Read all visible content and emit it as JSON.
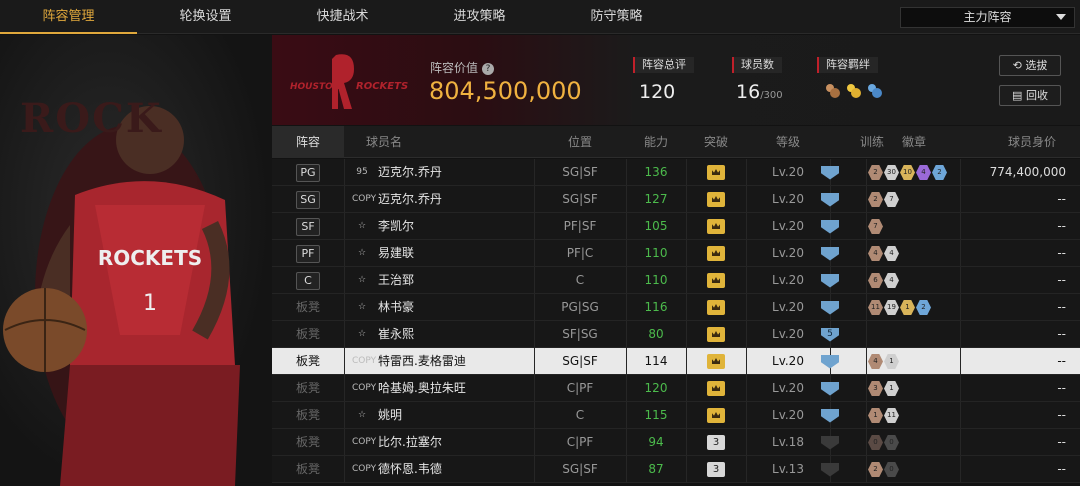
{
  "tabs": [
    {
      "label": "阵容管理"
    },
    {
      "label": "轮换设置"
    },
    {
      "label": "快捷战术"
    },
    {
      "label": "进攻策略"
    },
    {
      "label": "防守策略"
    }
  ],
  "lineup_select": {
    "value": "主力阵容"
  },
  "team": {
    "logo_text": "HOUSTON ROCKETS",
    "bg_text": "ROCK"
  },
  "lineup_value": {
    "label": "阵容价值",
    "value": "804,500,000"
  },
  "stats": {
    "rating_label": "阵容总评",
    "rating": "120",
    "players_label": "球员数",
    "players": "16",
    "players_max": "/300",
    "bond_label": "阵容羁绊"
  },
  "buttons": {
    "select": "选拔",
    "recycle": "回收"
  },
  "columns": {
    "slot": "阵容",
    "name": "球员名",
    "position": "位置",
    "ability": "能力",
    "breakthrough": "突破",
    "level": "等级",
    "training": "训练",
    "badges": "徽章",
    "worth": "球员身价"
  },
  "rows": [
    {
      "slot": "PG",
      "mark": "95",
      "name": "迈克尔.乔丹",
      "position": "SG|SF",
      "ability": "136",
      "breakthrough": "crown",
      "level": "Lv.20",
      "training": "shield",
      "badges": [
        {
          "n": "2",
          "c": "#b08a74"
        },
        {
          "n": "30",
          "c": "#cfcfcf"
        },
        {
          "n": "10",
          "c": "#d8b45a"
        },
        {
          "n": "4",
          "c": "#9a6ad8"
        },
        {
          "n": "2",
          "c": "#6ea6d8"
        }
      ],
      "worth": "774,400,000"
    },
    {
      "slot": "SG",
      "mark": "COPY",
      "name": "迈克尔.乔丹",
      "position": "SG|SF",
      "ability": "127",
      "breakthrough": "crown",
      "level": "Lv.20",
      "training": "shield",
      "badges": [
        {
          "n": "2",
          "c": "#b08a74"
        },
        {
          "n": "7",
          "c": "#cfcfcf"
        }
      ],
      "worth": "--"
    },
    {
      "slot": "SF",
      "mark": "star",
      "name": "李凯尔",
      "position": "PF|SF",
      "ability": "105",
      "breakthrough": "crown",
      "level": "Lv.20",
      "training": "shield",
      "badges": [
        {
          "n": "7",
          "c": "#b08a74"
        }
      ],
      "worth": "--"
    },
    {
      "slot": "PF",
      "mark": "star",
      "name": "易建联",
      "position": "PF|C",
      "ability": "110",
      "breakthrough": "crown",
      "level": "Lv.20",
      "training": "shield",
      "badges": [
        {
          "n": "4",
          "c": "#b08a74"
        },
        {
          "n": "4",
          "c": "#cfcfcf"
        }
      ],
      "worth": "--"
    },
    {
      "slot": "C",
      "mark": "star",
      "name": "王治郅",
      "position": "C",
      "ability": "110",
      "breakthrough": "crown",
      "level": "Lv.20",
      "training": "shield",
      "badges": [
        {
          "n": "6",
          "c": "#b08a74"
        },
        {
          "n": "4",
          "c": "#cfcfcf"
        }
      ],
      "worth": "--"
    },
    {
      "slot": "板凳",
      "mark": "star",
      "name": "林书豪",
      "position": "PG|SG",
      "ability": "116",
      "breakthrough": "crown",
      "level": "Lv.20",
      "training": "shield",
      "badges": [
        {
          "n": "11",
          "c": "#b08a74"
        },
        {
          "n": "19",
          "c": "#cfcfcf"
        },
        {
          "n": "1",
          "c": "#d8b45a"
        },
        {
          "n": "2",
          "c": "#6ea6d8"
        }
      ],
      "worth": "--"
    },
    {
      "slot": "板凳",
      "mark": "star",
      "name": "崔永熙",
      "position": "SF|SG",
      "ability": "80",
      "breakthrough": "crown",
      "level": "Lv.20",
      "training": "shield5",
      "badges": [],
      "worth": "--"
    },
    {
      "slot": "板凳",
      "mark": "COPY",
      "name": "特雷西.麦格雷迪",
      "position": "SG|SF",
      "ability": "114",
      "breakthrough": "crown",
      "level": "Lv.20",
      "training": "shield",
      "badges": [
        {
          "n": "4",
          "c": "#b08a74"
        },
        {
          "n": "1",
          "c": "#cfcfcf"
        }
      ],
      "worth": "--",
      "selected": true
    },
    {
      "slot": "板凳",
      "mark": "COPY",
      "name": "哈基姆.奥拉朱旺",
      "position": "C|PF",
      "ability": "120",
      "breakthrough": "crown",
      "level": "Lv.20",
      "training": "shield",
      "badges": [
        {
          "n": "3",
          "c": "#b08a74"
        },
        {
          "n": "1",
          "c": "#cfcfcf"
        }
      ],
      "worth": "--"
    },
    {
      "slot": "板凳",
      "mark": "star",
      "name": "姚明",
      "position": "C",
      "ability": "115",
      "breakthrough": "crown",
      "level": "Lv.20",
      "training": "shield",
      "badges": [
        {
          "n": "1",
          "c": "#b08a74"
        },
        {
          "n": "11",
          "c": "#cfcfcf"
        }
      ],
      "worth": "--"
    },
    {
      "slot": "板凳",
      "mark": "COPY",
      "name": "比尔.拉塞尔",
      "position": "C|PF",
      "ability": "94",
      "breakthrough": "3",
      "level": "Lv.18",
      "training": "dim",
      "badges": [
        {
          "n": "0",
          "c": "#5a4a44"
        },
        {
          "n": "0",
          "c": "#4a4a4a"
        }
      ],
      "worth": "--"
    },
    {
      "slot": "板凳",
      "mark": "COPY",
      "name": "德怀恩.韦德",
      "position": "SG|SF",
      "ability": "87",
      "breakthrough": "3",
      "level": "Lv.13",
      "training": "dim",
      "badges": [
        {
          "n": "2",
          "c": "#b08a74"
        },
        {
          "n": "0",
          "c": "#4a4a4a"
        }
      ],
      "worth": "--"
    }
  ]
}
